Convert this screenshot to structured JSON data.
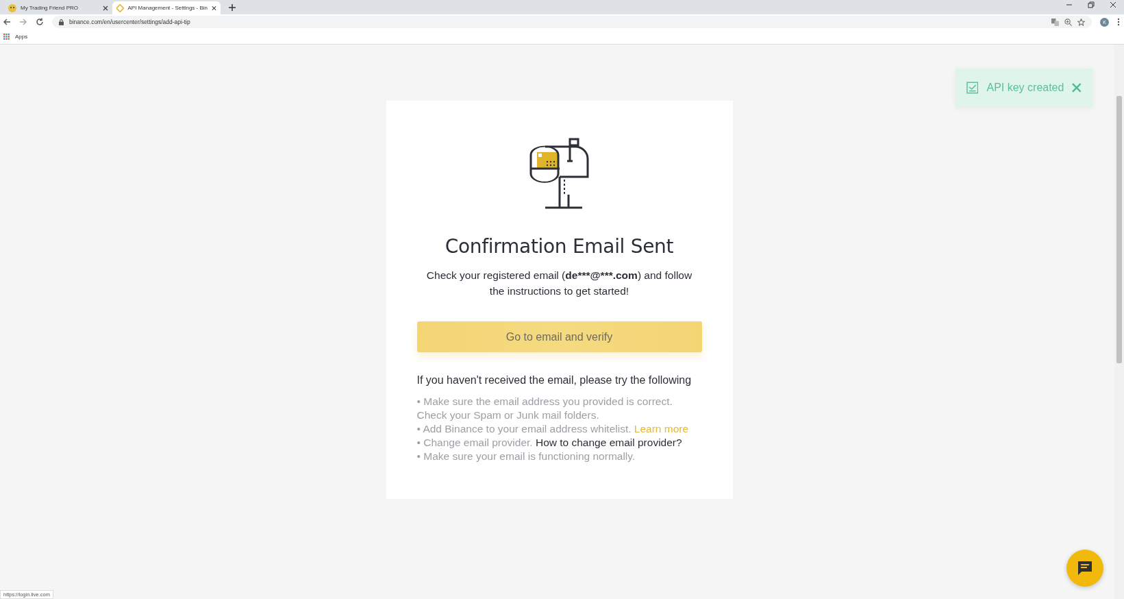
{
  "tabs": [
    {
      "title": "My Trading Friend PRO",
      "selected": false,
      "kind": "smiley"
    },
    {
      "title": "API Management - Settings - Bin",
      "selected": true,
      "kind": "diamond"
    }
  ],
  "address_bar": {
    "url": "binance.com/en/usercenter/settings/add-api-tip"
  },
  "bookmarks": [
    {
      "label": "Apps"
    }
  ],
  "profile": {
    "initial": "K"
  },
  "toast": {
    "message": "API key created"
  },
  "card": {
    "title": "Confirmation Email Sent",
    "message_start": "Check your registered email (",
    "email": "de***@***.com",
    "message_end": ") and follow the instructions to get started!",
    "button": "Go to email and verify",
    "help_heading": "If you haven't received the email, please try the following",
    "help_lines": [
      {
        "text": "• Make sure the email address you provided is correct."
      },
      {
        "text": "Check your Spam or Junk mail folders."
      },
      {
        "text": "• Add Binance to your email address whitelist.",
        "link": {
          "label": "Learn more",
          "kind": "accent"
        }
      },
      {
        "text": "• Change email provider.",
        "link": {
          "label": "How to change email provider?",
          "kind": "plain"
        }
      },
      {
        "text": "• Make sure your email is functioning normally."
      }
    ]
  },
  "status_url": "https://login.live.com"
}
